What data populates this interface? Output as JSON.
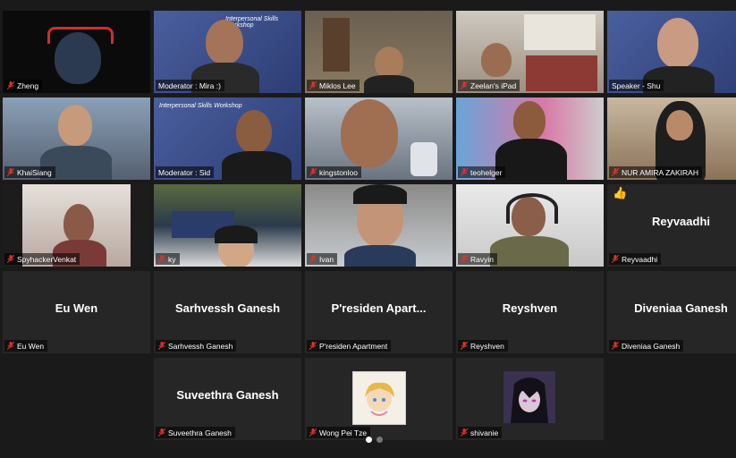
{
  "participants": [
    {
      "name": "Zheng",
      "type": "video"
    },
    {
      "name": "Moderator : Mira :)",
      "type": "video"
    },
    {
      "name": "Miklos Lee",
      "type": "video"
    },
    {
      "name": "Zeelan's iPad",
      "type": "video"
    },
    {
      "name": "Speaker - Shu",
      "type": "video"
    },
    {
      "name": "KhaiSiang",
      "type": "video"
    },
    {
      "name": "Moderator : Sid",
      "type": "video",
      "active_speaker": true
    },
    {
      "name": "kingstonloo",
      "type": "video"
    },
    {
      "name": "teohelger",
      "type": "video"
    },
    {
      "name": "NUR AMIRA ZAKIRAH",
      "type": "video"
    },
    {
      "name": "SpyhackerVenkat",
      "type": "video"
    },
    {
      "name": "ky",
      "type": "video"
    },
    {
      "name": "Ivan",
      "type": "video"
    },
    {
      "name": "Ravyin",
      "type": "video"
    },
    {
      "name": "Reyvaadhi",
      "display": "Reyvaadhi",
      "type": "name",
      "reaction": "thumbs-up"
    },
    {
      "name": "Eu Wen",
      "display": "Eu Wen",
      "type": "name"
    },
    {
      "name": "Sarhvessh Ganesh",
      "display": "Sarhvessh Ganesh",
      "type": "name"
    },
    {
      "name": "P'residen Apartment",
      "display": "P'residen  Apart...",
      "type": "name"
    },
    {
      "name": "Reyshven",
      "display": "Reyshven",
      "type": "name"
    },
    {
      "name": "Diveniaa Ganesh",
      "display": "Diveniaa Ganesh",
      "type": "name"
    },
    {
      "name": "Suveethra Ganesh",
      "display": "Suveethra Ganesh",
      "type": "name"
    },
    {
      "name": "Wong Pei Tze",
      "type": "avatar"
    },
    {
      "name": "shivanie",
      "type": "avatar"
    }
  ],
  "banner_text": "Interpersonal Skills Workshop",
  "pagination": {
    "pages": 2,
    "current": 1
  },
  "colors": {
    "background": "#1a1a1a",
    "tile": "#262626",
    "speaker_border": "#e6e84a",
    "mute": "#e0322b"
  }
}
